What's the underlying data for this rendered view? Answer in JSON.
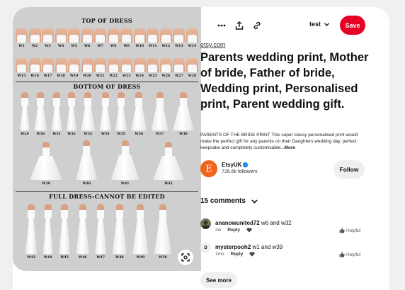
{
  "pin_image": {
    "section_titles": [
      "TOP OF DRESS",
      "BOTTOM OF DRESS",
      "FULL DRESS-CANNOT BE EDITED"
    ],
    "tops_row1": [
      "W1",
      "W2",
      "W3",
      "W4",
      "W5",
      "W6",
      "W7",
      "W8",
      "W9",
      "W10",
      "W11",
      "W12",
      "W13",
      "W14"
    ],
    "tops_row2": [
      "W15",
      "W16",
      "W17",
      "W18",
      "W19",
      "W20",
      "W21",
      "W22",
      "W23",
      "W24",
      "W25",
      "W26",
      "W27",
      "W28"
    ],
    "bottoms_row1": [
      "W29",
      "W30",
      "W31",
      "W32",
      "W33",
      "W34",
      "W35",
      "W36",
      "W37",
      "W38"
    ],
    "bottoms_row2": [
      "W39",
      "W40",
      "W41",
      "W42"
    ],
    "full_dresses": [
      "W43",
      "W44",
      "W45",
      "W46",
      "W47",
      "W48",
      "W49",
      "W50"
    ]
  },
  "toolbar": {
    "board_name": "test",
    "save_label": "Save"
  },
  "pin": {
    "source": "etsy.com",
    "title": "Parents wedding print, Mother of bride, Father of bride, Wedding print, Personalised print, Parent wedding gift.",
    "description": "PARENTS OF THE BRIDE PRINT This super classy personalised print would make the perfect gift for any parents on their Daughters wedding day. perfect keepsake and completely customisable...",
    "more_label": "More"
  },
  "creator": {
    "avatar_letter": "E",
    "name": "EtsyUK",
    "followers": "726.6k followers",
    "follow_label": "Follow",
    "avatar_color": "#f1641e"
  },
  "comments": {
    "header": "15 comments",
    "items": [
      {
        "user": "ananowunited72",
        "text": "w6 and w32",
        "age": "2w",
        "reply_label": "Reply",
        "helpful_label": "Helpful",
        "avatar_letter": ""
      },
      {
        "user": "mysterpooh2",
        "text": "w1 and w39",
        "age": "1mo",
        "reply_label": "Reply",
        "helpful_label": "Helpful",
        "avatar_letter": "D"
      }
    ],
    "see_more_label": "See more"
  },
  "colors": {
    "save_red": "#e60023",
    "verified_blue": "#0074e8",
    "button_gray": "#efefef"
  }
}
